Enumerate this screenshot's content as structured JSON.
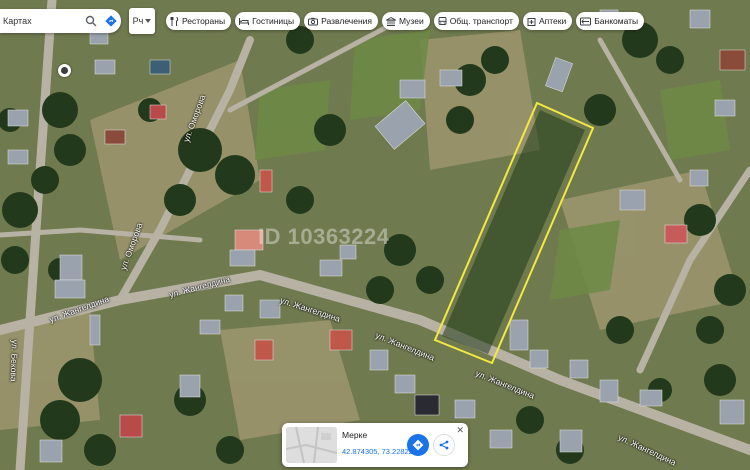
{
  "search": {
    "value": "Картах"
  },
  "lang_button": {
    "label": "Рч"
  },
  "chips": [
    {
      "label": "Рестораны",
      "icon": "fork-knife-icon"
    },
    {
      "label": "Гостиницы",
      "icon": "bed-icon"
    },
    {
      "label": "Развлечения",
      "icon": "camera-icon"
    },
    {
      "label": "Музеи",
      "icon": "museum-icon"
    },
    {
      "label": "Общ. транспорт",
      "icon": "bus-icon"
    },
    {
      "label": "Аптеки",
      "icon": "pharmacy-icon"
    },
    {
      "label": "Банкоматы",
      "icon": "atm-icon"
    }
  ],
  "watermark": "ID 10363224",
  "streets": {
    "s1": "ул. Оморова",
    "s2": "ул. Оморова",
    "s3": "ул. Жангелдина",
    "s4": "ул. Жангелдина",
    "s5": "ул. Жангелдина",
    "s6": "ул. Жангелдина",
    "s7": "ул. Жангелдина",
    "s8": "ул. Жангелдина",
    "s9": "ул. Бекова"
  },
  "place": {
    "name": "Мерке",
    "coords": "42.874305, 73.228225",
    "close": "✕"
  },
  "colors": {
    "boundary": "#f4e842",
    "accent": "#1a73e8"
  }
}
